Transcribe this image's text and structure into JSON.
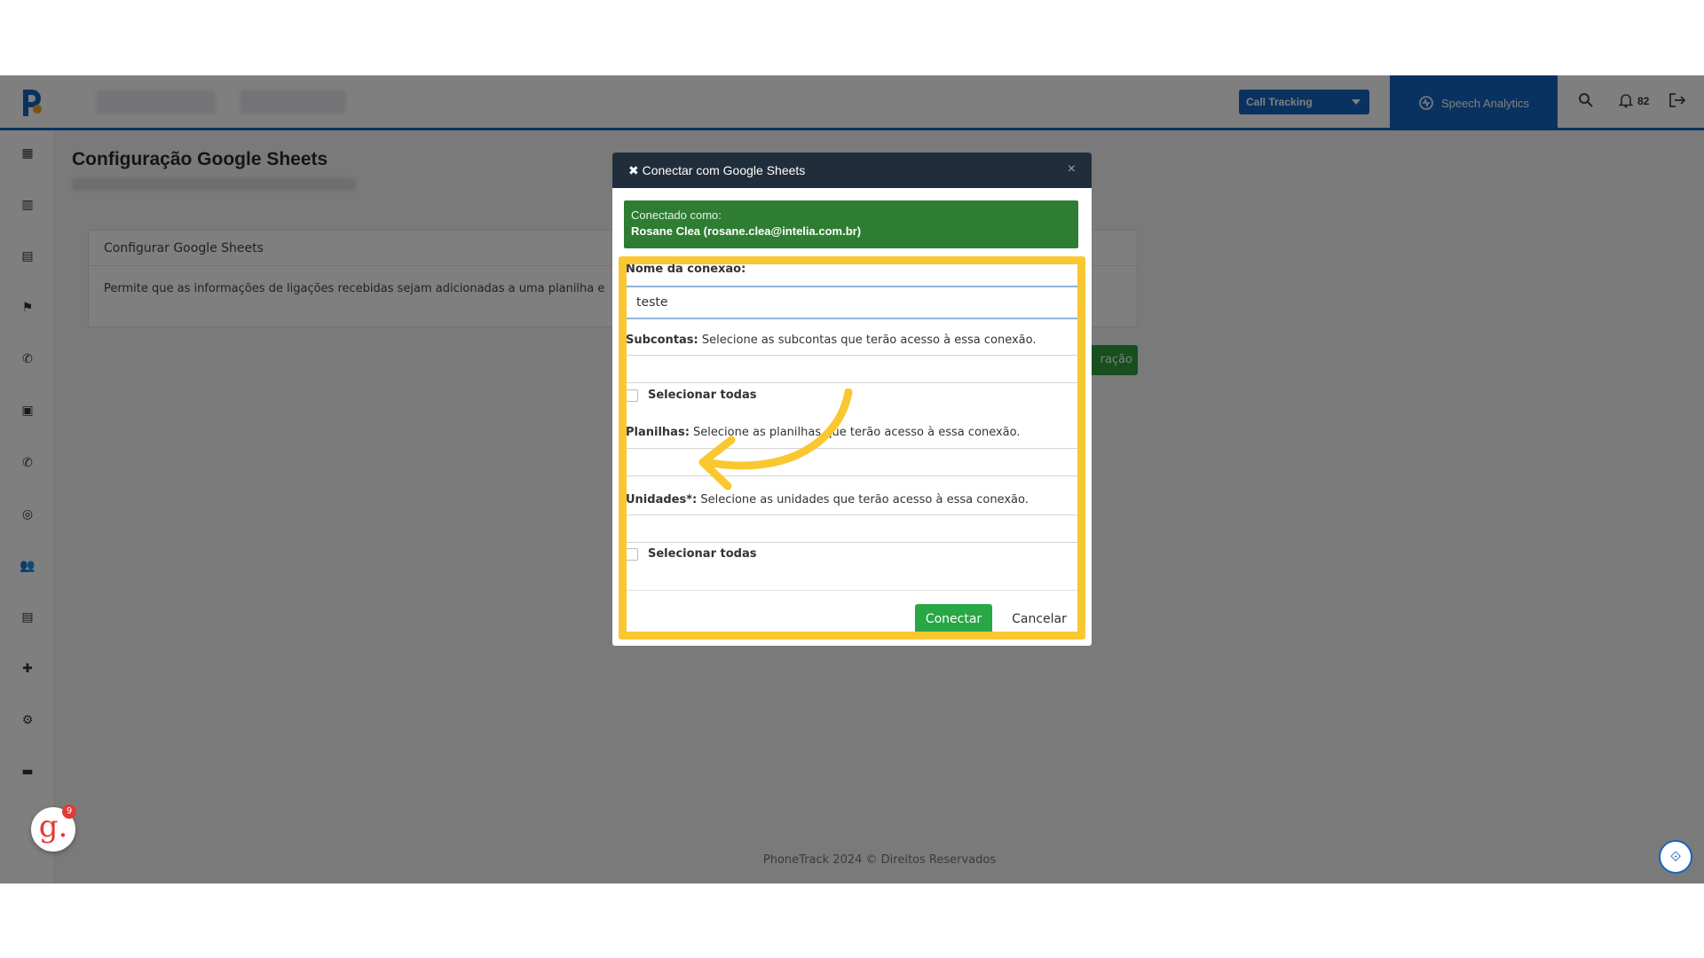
{
  "topbar": {
    "call_tracking_label": "Call Tracking",
    "speech_label": "Speech Analytics",
    "notifications_count": "82"
  },
  "page": {
    "title": "Configuração Google Sheets",
    "card_title": "Configurar Google Sheets",
    "card_text": "Permite que as informações de ligações recebidas sejam adicionadas a uma planilha e",
    "green_button_partial": "ração"
  },
  "footer": {
    "text": "PhoneTrack 2024 © Direitos Reservados"
  },
  "chat": {
    "badge": "9",
    "logo": "g."
  },
  "modal": {
    "title": "✖ Conectar com Google Sheets",
    "close": "×",
    "alert_label": "Conectado como:",
    "alert_user": "Rosane Clea (rosane.clea@intelia.com.br)",
    "name_label": "Nome da conexão:",
    "name_value": "teste",
    "subaccounts_label": "Subcontas:",
    "subaccounts_hint": "Selecione as subcontas que terão acesso à essa conexão.",
    "subaccounts_select_all": "Selecionar todas",
    "sheets_label": "Planilhas:",
    "sheets_hint": "Selecione as planilhas que terão acesso à essa conexão.",
    "units_label": "Unidades*:",
    "units_hint": "Selecione as unidades que terão acesso à essa conexão.",
    "units_select_all": "Selecionar todas",
    "connect_button": "Conectar",
    "cancel_button": "Cancelar"
  },
  "colors": {
    "highlight": "#f9c830",
    "brand_blue": "#1565c0",
    "success_green": "#28a745",
    "modal_header": "#202d3b"
  },
  "icons": {
    "sidebar": [
      "dashboard-icon",
      "building-icon",
      "briefcase-icon",
      "flag-icon",
      "phone-icon",
      "contact-card-icon",
      "phone-icon",
      "target-icon",
      "users-icon",
      "book-icon",
      "puzzle-icon",
      "gear-icon",
      "store-icon"
    ],
    "topbar": [
      "search-icon",
      "bell-icon",
      "logout-icon",
      "speech-analytics-icon"
    ]
  }
}
